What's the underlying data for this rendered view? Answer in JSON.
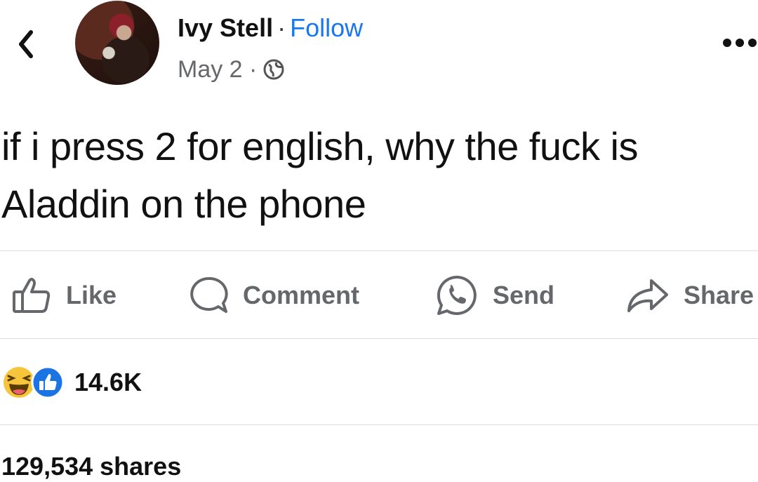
{
  "post": {
    "author": "Ivy Stell",
    "separator": "·",
    "follow_label": "Follow",
    "date": "May 2 ·",
    "text": "if i press 2 for english, why the fuck is Aladdin on the phone"
  },
  "actions": {
    "like": "Like",
    "comment": "Comment",
    "send": "Send",
    "share": "Share"
  },
  "stats": {
    "reactions_count": "14.6K",
    "shares": "129,534 shares"
  },
  "icons": {
    "back": "chevron-left-icon",
    "more": "more-dots-icon",
    "privacy": "globe-icon",
    "reactions": [
      "haha-reaction-icon",
      "like-reaction-icon"
    ]
  },
  "colors": {
    "link": "#1877f2",
    "muted": "#65676b",
    "divider": "#dcdcdc"
  }
}
